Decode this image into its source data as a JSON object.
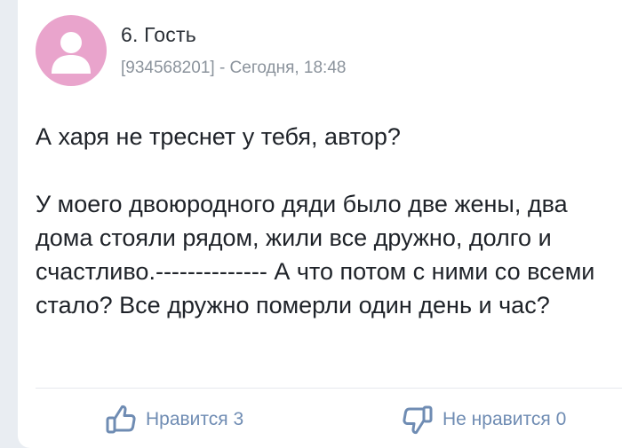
{
  "comment": {
    "author": "6. Гость",
    "meta": "[934568201] - Сегодня, 18:48",
    "avatar_icon": "default-user-avatar",
    "avatar_color": "#e9a4cc",
    "body": [
      "А харя не треснет у тебя, автор?",
      "У моего двоюродного дяди было две жены, два дома стояли рядом, жили все дружно, долго и счастливо.-------------- А что потом с ними со всеми стало? Все дружно померли один день и час?"
    ],
    "actions": {
      "like_label": "Нравится 3",
      "dislike_label": "Не нравится 0",
      "like_icon": "thumbs-up-icon",
      "dislike_icon": "thumbs-down-icon",
      "accent_color": "#6f8cb3"
    }
  }
}
